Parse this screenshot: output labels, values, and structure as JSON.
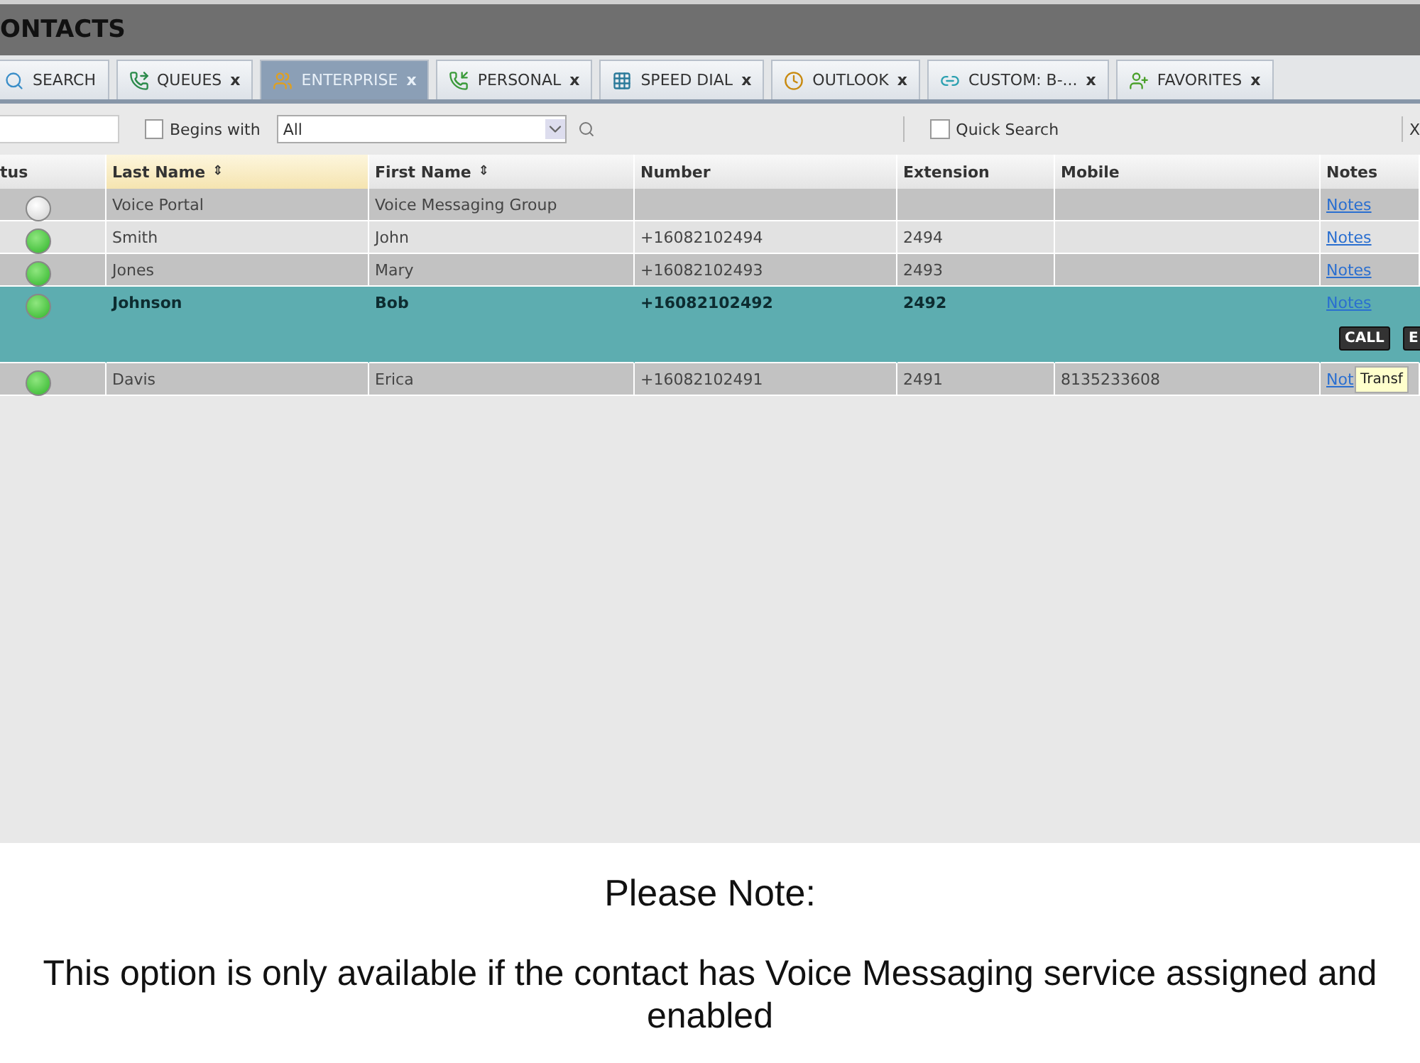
{
  "window": {
    "title": "ONTACTS"
  },
  "tabs": [
    {
      "label": "SEARCH",
      "kind": "search",
      "selected": false
    },
    {
      "label": "QUEUES",
      "kind": "queue",
      "close": "x",
      "selected": false
    },
    {
      "label": "ENTERPRISE",
      "kind": "people",
      "close": "x",
      "selected": true
    },
    {
      "label": "PERSONAL",
      "kind": "phone",
      "close": "x",
      "selected": false
    },
    {
      "label": "SPEED DIAL",
      "kind": "grid",
      "close": "x",
      "selected": false
    },
    {
      "label": "OUTLOOK",
      "kind": "clock",
      "close": "x",
      "selected": false
    },
    {
      "label": "CUSTOM: B-...",
      "kind": "link",
      "close": "x",
      "selected": false
    },
    {
      "label": "FAVORITES",
      "kind": "favorite",
      "close": "x",
      "selected": false
    }
  ],
  "filter": {
    "begins_with": {
      "label": "Begins with",
      "checked": false
    },
    "dropdown_value": "All",
    "quick_search": {
      "label": "Quick Search",
      "checked": false
    },
    "close": "X"
  },
  "table": {
    "columns": [
      {
        "label": "tus",
        "sorted": false
      },
      {
        "label": "Last Name",
        "sorted": true,
        "sort_mark": "⇕"
      },
      {
        "label": "First Name",
        "sorted": false,
        "sort_mark": "⇕"
      },
      {
        "label": "Number",
        "sorted": false
      },
      {
        "label": "Extension",
        "sorted": false
      },
      {
        "label": "Mobile",
        "sorted": false
      },
      {
        "label": "Notes",
        "sorted": false
      }
    ],
    "rows": [
      {
        "online": false,
        "last": "Voice Portal",
        "first": "Voice Messaging Group",
        "number": "",
        "extension": "",
        "mobile": "",
        "notes": "Notes",
        "selected": false
      },
      {
        "online": true,
        "last": "Smith",
        "first": "John",
        "number": "+16082102494",
        "extension": "2494",
        "mobile": "",
        "notes": "Notes",
        "selected": false
      },
      {
        "online": true,
        "last": "Jones",
        "first": "Mary",
        "number": "+16082102493",
        "extension": "2493",
        "mobile": "",
        "notes": "Notes",
        "selected": false
      },
      {
        "online": true,
        "last": "Johnson",
        "first": "Bob",
        "number": "+16082102492",
        "extension": "2492",
        "mobile": "",
        "notes": "Notes",
        "selected": true,
        "actions": [
          "CALL",
          "E"
        ]
      },
      {
        "online": true,
        "last": "Davis",
        "first": "Erica",
        "number": "+16082102491",
        "extension": "2491",
        "mobile": "8135233608",
        "notes": "Not",
        "selected": false,
        "tooltip": "Transf"
      }
    ]
  },
  "note": {
    "heading": "Please Note:",
    "text": "This option is only available if the contact has Voice Messaging service assigned and enabled"
  }
}
